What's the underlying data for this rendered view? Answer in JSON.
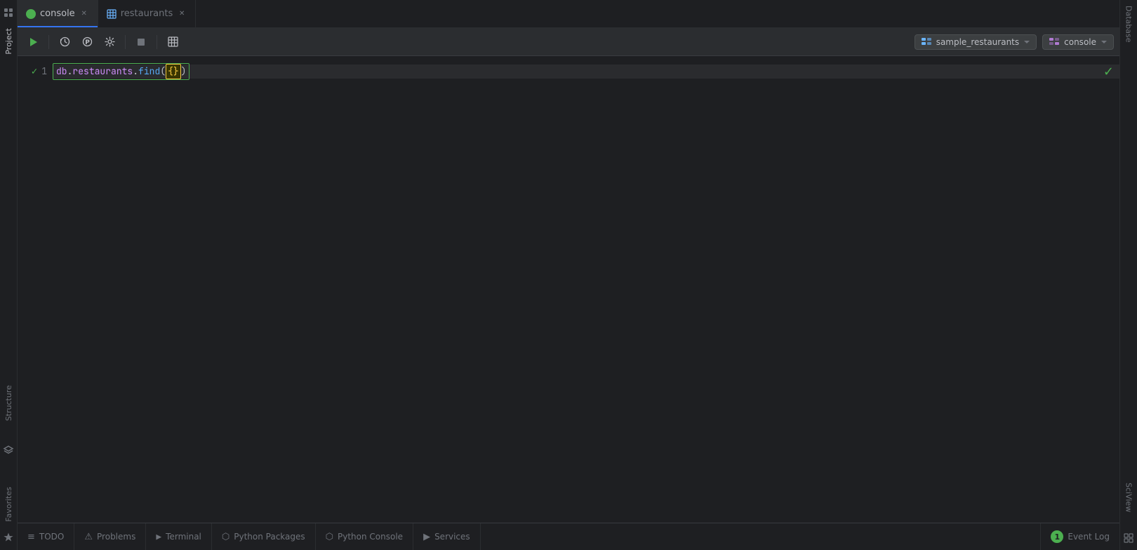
{
  "tabs": [
    {
      "id": "console",
      "label": "console",
      "icon": "mongo",
      "active": true,
      "closable": true
    },
    {
      "id": "restaurants",
      "label": "restaurants",
      "icon": "table",
      "active": false,
      "closable": true
    }
  ],
  "toolbar": {
    "run_label": "Run",
    "history_label": "History",
    "profiler_label": "Profiler",
    "settings_label": "Settings",
    "stop_label": "Stop",
    "table_label": "Table View",
    "db_selector": "sample_restaurants",
    "console_selector": "console"
  },
  "editor": {
    "line1": {
      "number": "1",
      "code_prefix": "db.restaurants.find(",
      "code_cursor": "{}",
      "code_suffix": ")"
    }
  },
  "status_bar": {
    "todo_label": "TODO",
    "problems_label": "Problems",
    "terminal_label": "Terminal",
    "python_packages_label": "Python Packages",
    "python_console_label": "Python Console",
    "services_label": "Services",
    "event_log_label": "Event Log",
    "event_log_count": "1"
  },
  "left_sidebar": {
    "project_label": "Project",
    "structure_label": "Structure",
    "favorites_label": "Favorites"
  },
  "right_sidebar": {
    "database_label": "Database",
    "sciview_label": "SciView"
  }
}
